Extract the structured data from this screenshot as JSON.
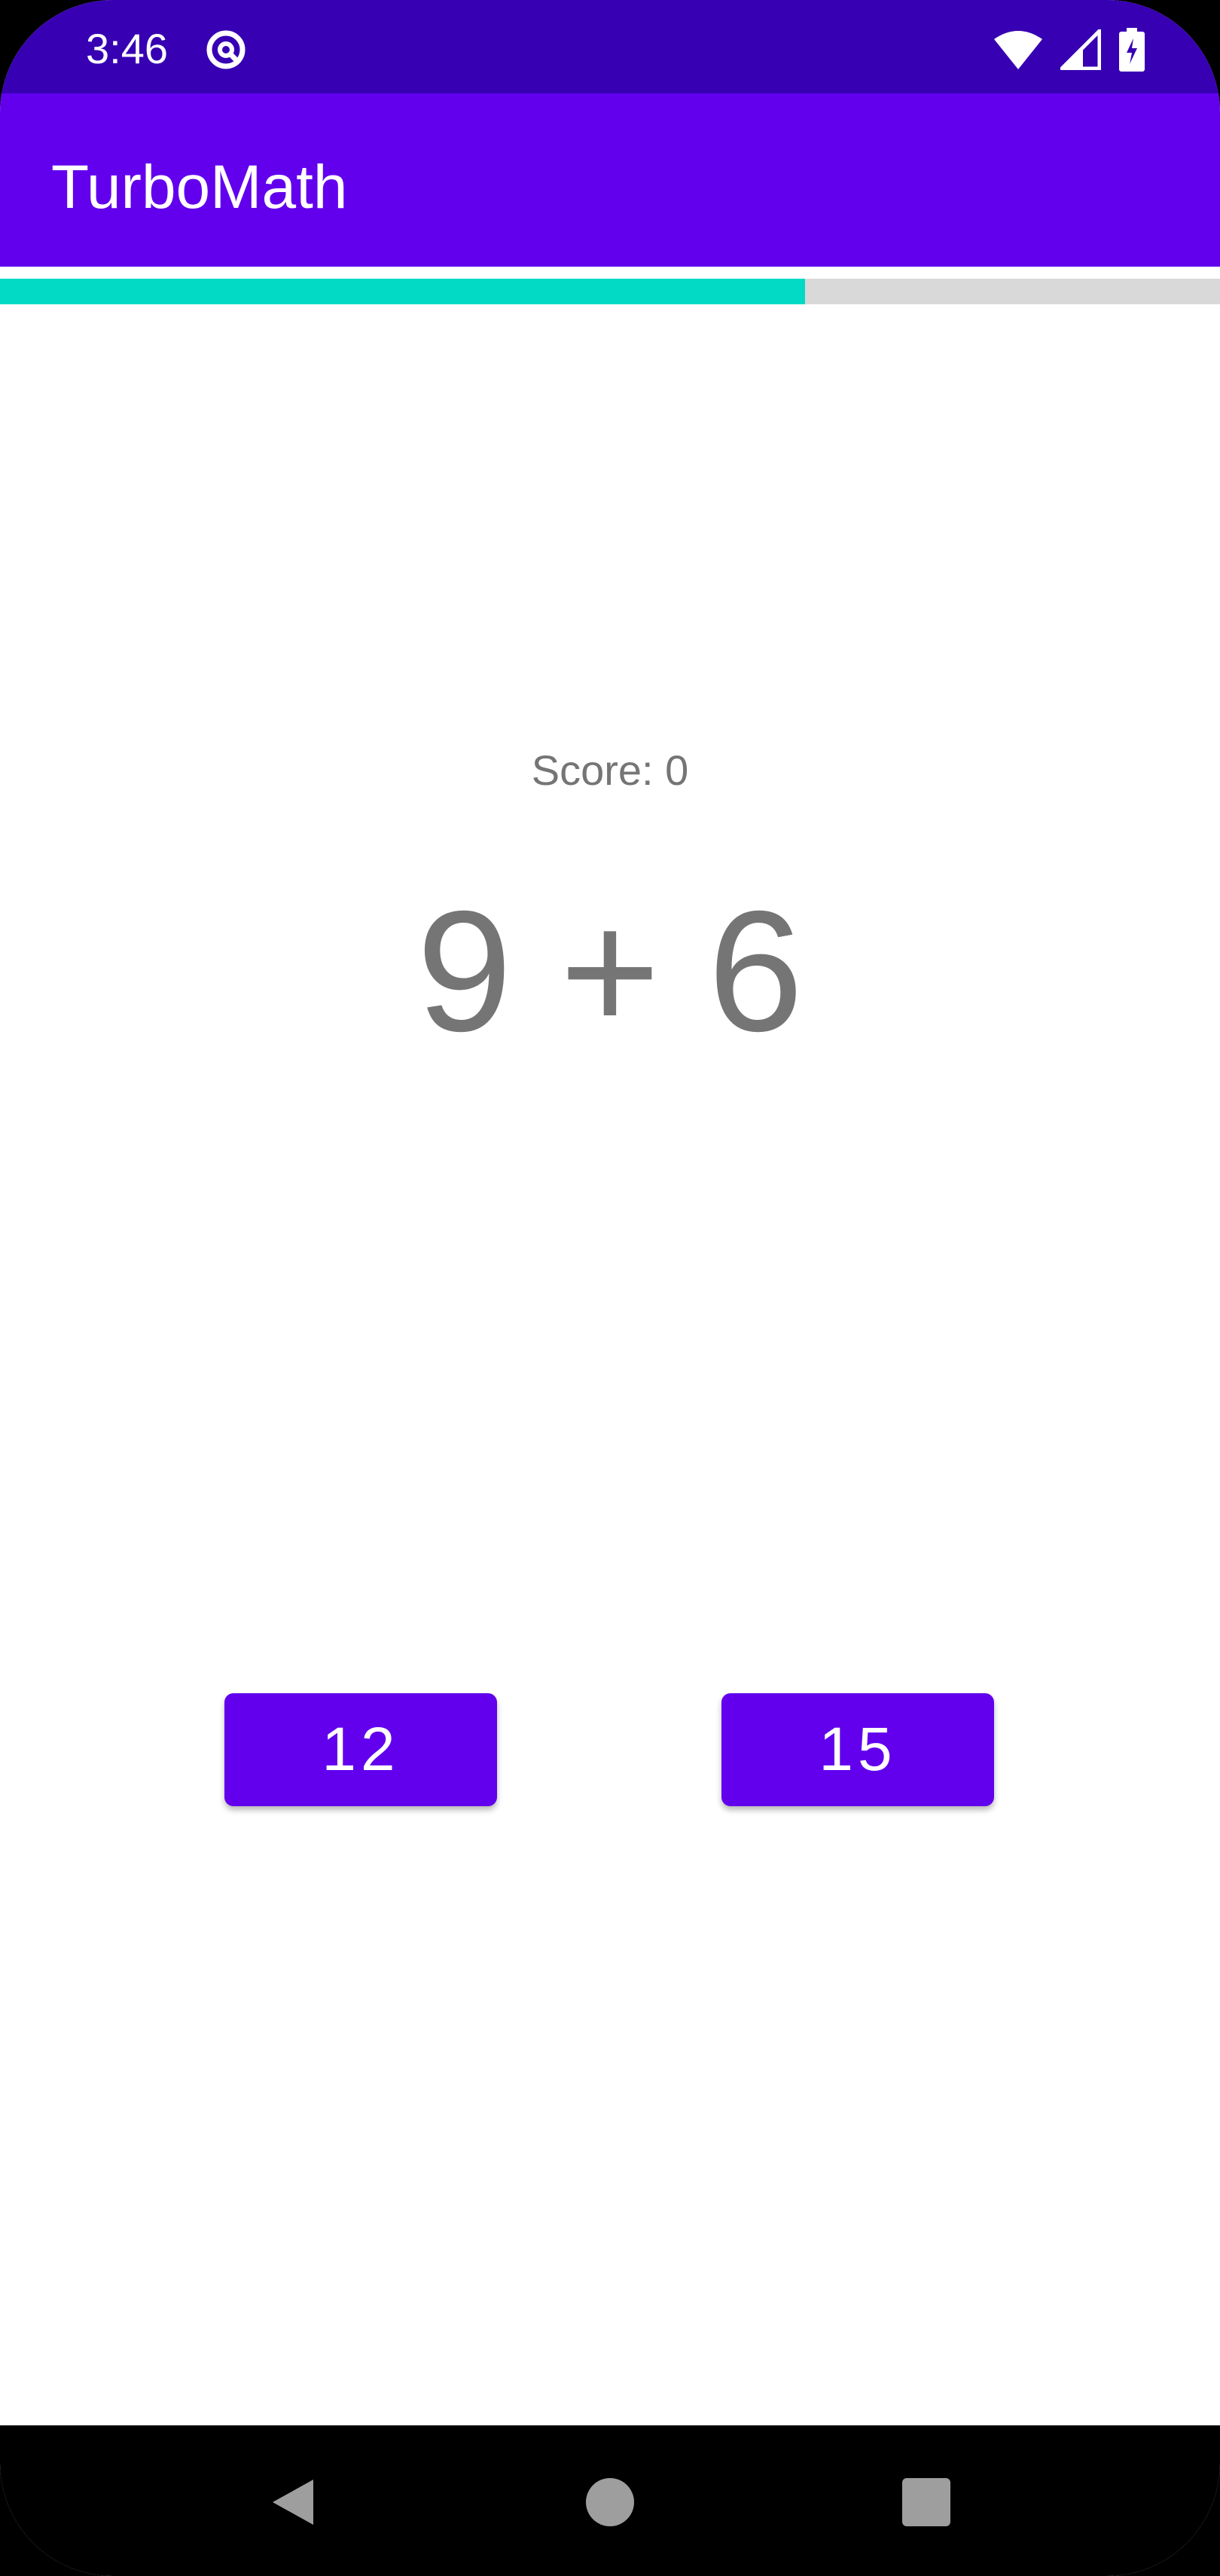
{
  "status_bar": {
    "time": "3:46",
    "app_icon": "app-notification-icon",
    "icons": [
      "wifi-icon",
      "cell-signal-icon",
      "battery-charging-icon"
    ]
  },
  "app_bar": {
    "title": "TurboMath"
  },
  "timer": {
    "progress_fraction": 0.66,
    "fill_color": "#03dac5",
    "track_color": "#d9d9d9"
  },
  "game": {
    "score_label": "Score: 0",
    "question": "9 + 6"
  },
  "answers": [
    {
      "label": "12"
    },
    {
      "label": "15"
    }
  ],
  "nav_bar": {
    "icons": [
      "back-icon",
      "home-icon",
      "recents-icon"
    ]
  },
  "colors": {
    "primary": "#6200ee",
    "primary_dark": "#3700b3",
    "accent": "#03dac5"
  }
}
